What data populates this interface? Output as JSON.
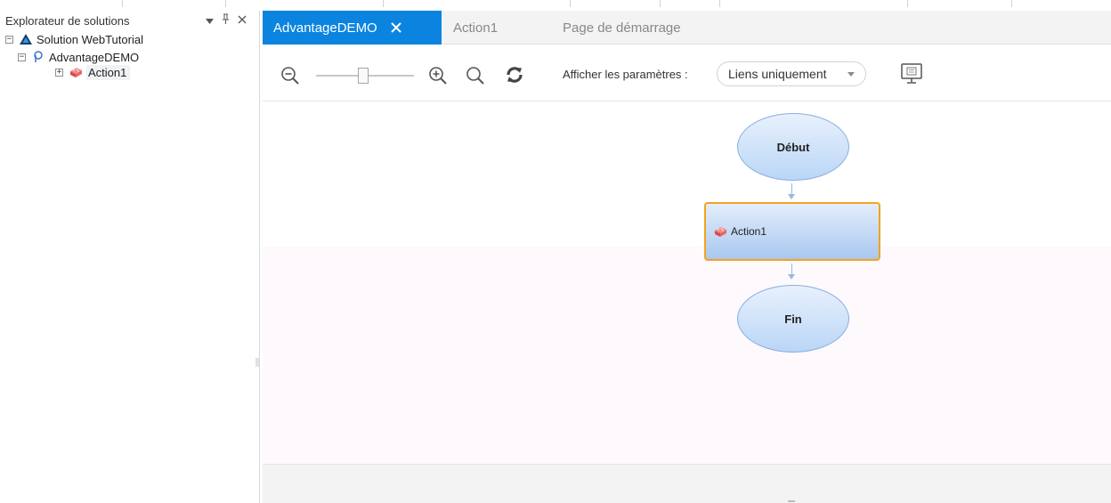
{
  "explorer": {
    "title": "Explorateur de solutions",
    "tree": {
      "solution": {
        "toggle": "−",
        "label": "Solution WebTutorial",
        "icon": "solution-icon"
      },
      "test": {
        "toggle": "−",
        "label": "AdvantageDEMO",
        "icon": "gui-test-icon"
      },
      "action": {
        "toggle": "+",
        "label": "Action1",
        "icon": "action-brick-icon"
      }
    }
  },
  "tabs": [
    {
      "label": "AdvantageDEMO",
      "active": true
    },
    {
      "label": "Action1",
      "active": false
    },
    {
      "label": "Page de démarrage",
      "active": false
    }
  ],
  "toolbar": {
    "zoom_level": 0.48,
    "show_params_label": "Afficher les paramètres :",
    "show_params_value": "Liens uniquement"
  },
  "flow": {
    "start_label": "Début",
    "action_label": "Action1",
    "end_label": "Fin"
  },
  "colors": {
    "accent": "#0b84e0",
    "node_fill": "#bad6f6",
    "node_border": "#8aaee0",
    "selected_border": "#f3a31e"
  }
}
